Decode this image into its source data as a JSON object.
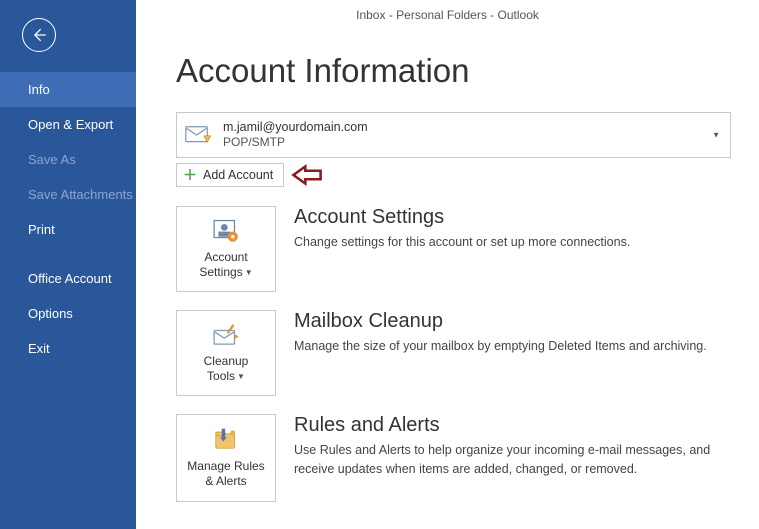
{
  "window_title": "Inbox - Personal Folders - Outlook",
  "page_heading": "Account Information",
  "sidebar": {
    "items": [
      {
        "label": "Info"
      },
      {
        "label": "Open & Export"
      },
      {
        "label": "Save As"
      },
      {
        "label": "Save Attachments"
      },
      {
        "label": "Print"
      },
      {
        "label": "Office Account"
      },
      {
        "label": "Options"
      },
      {
        "label": "Exit"
      }
    ]
  },
  "account": {
    "email": "m.jamil@yourdomain.com",
    "protocol": "POP/SMTP"
  },
  "add_account_label": "Add Account",
  "sections": {
    "settings": {
      "tile_line1": "Account",
      "tile_line2": "Settings",
      "heading": "Account Settings",
      "desc": "Change settings for this account or set up more connections."
    },
    "cleanup": {
      "tile_line1": "Cleanup",
      "tile_line2": "Tools",
      "heading": "Mailbox Cleanup",
      "desc": "Manage the size of your mailbox by emptying Deleted Items and archiving."
    },
    "rules": {
      "tile_line1": "Manage Rules",
      "tile_line2": "& Alerts",
      "heading": "Rules and Alerts",
      "desc": "Use Rules and Alerts to help organize your incoming e-mail messages, and receive updates when items are added, changed, or removed."
    }
  }
}
